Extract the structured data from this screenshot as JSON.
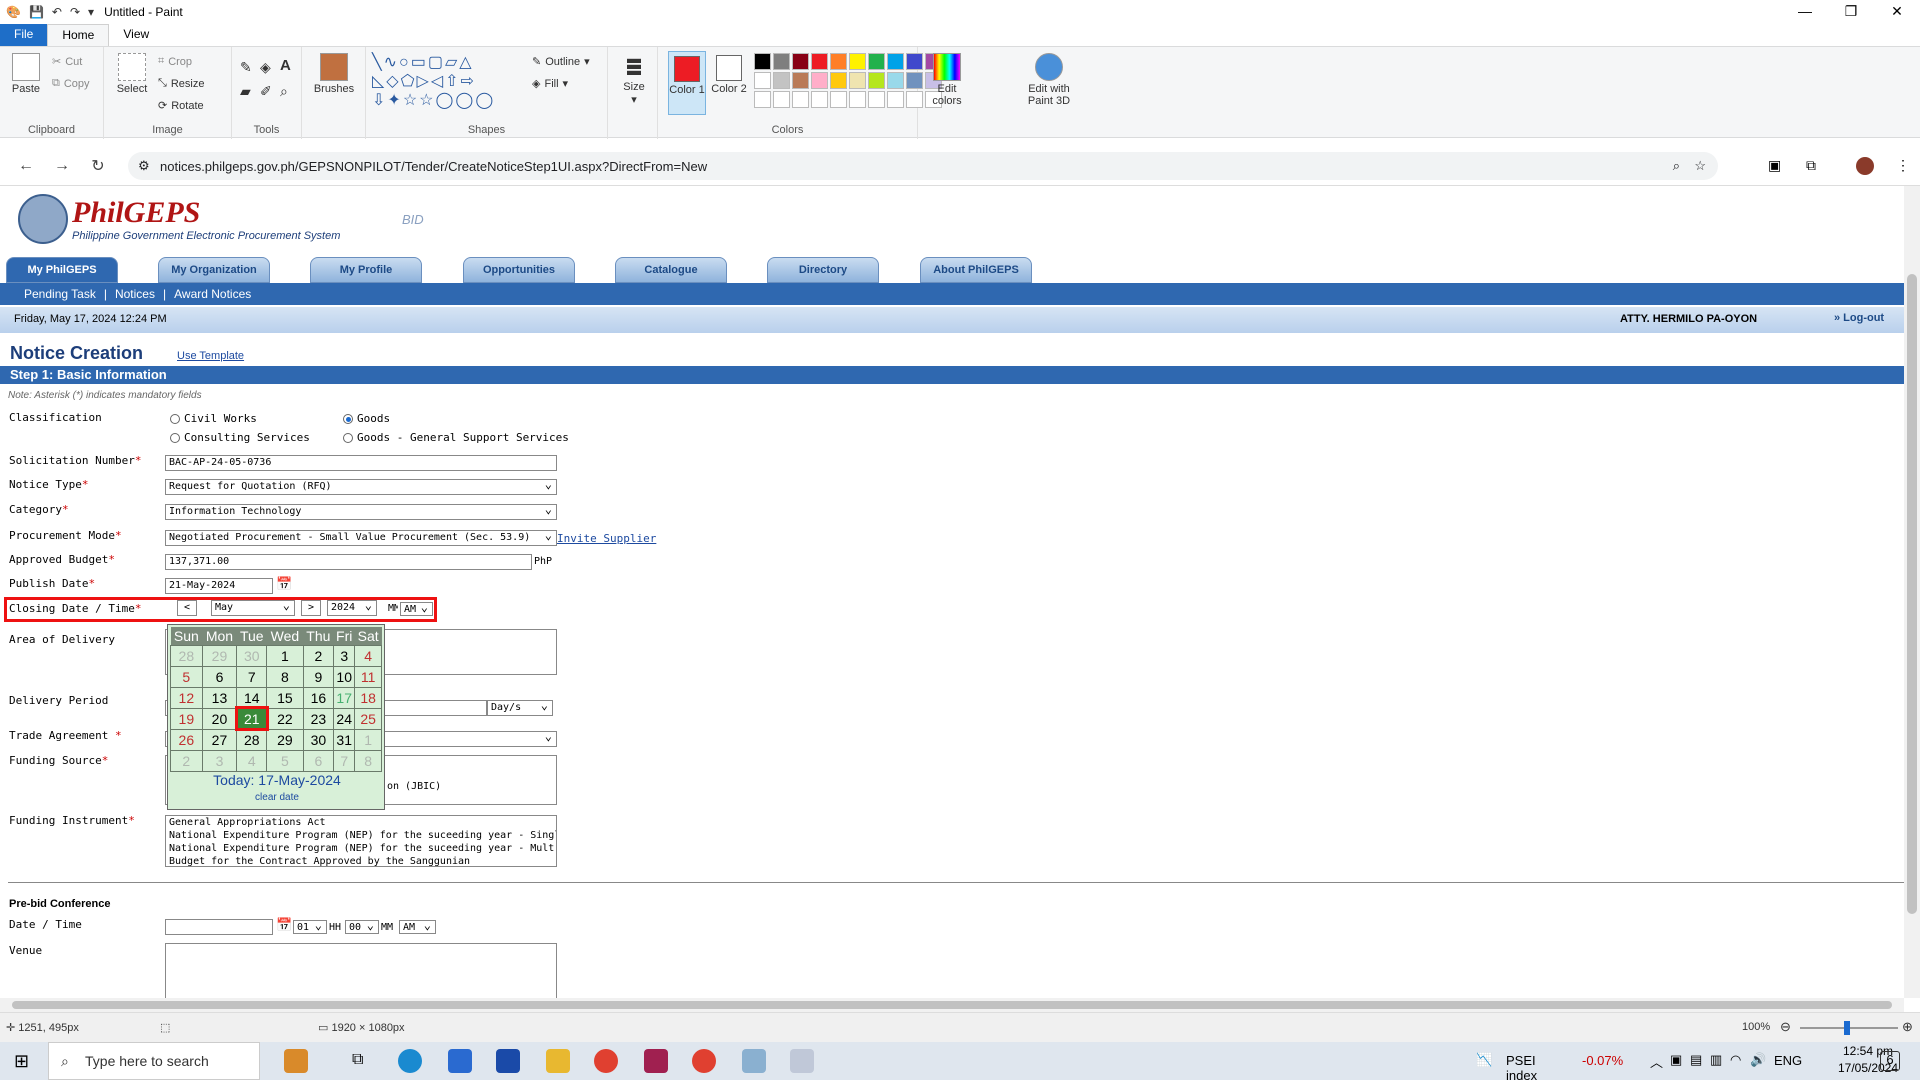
{
  "paint": {
    "window_title": "Untitled - Paint",
    "tabs": [
      "File",
      "Home",
      "View"
    ],
    "clipboard": {
      "paste": "Paste",
      "cut": "Cut",
      "copy": "Copy",
      "group": "Clipboard"
    },
    "image": {
      "select": "Select",
      "crop": "Crop",
      "resize": "Resize",
      "rotate": "Rotate",
      "group": "Image"
    },
    "tools": {
      "group": "Tools"
    },
    "brushes": "Brushes",
    "shapes": {
      "outline": "Outline",
      "fill": "Fill",
      "group": "Shapes"
    },
    "size": "Size",
    "color1": "Color 1",
    "color2": "Color 2",
    "colors_group": "Colors",
    "edit_colors": "Edit colors",
    "edit_paint3d": "Edit with Paint 3D",
    "palette": [
      "#000000",
      "#7f7f7f",
      "#880015",
      "#ed1c24",
      "#ff7f27",
      "#fff200",
      "#22b14c",
      "#00a2e8",
      "#3f48cc",
      "#a349a4",
      "#ffffff",
      "#c3c3c3",
      "#b97a57",
      "#ffaec9",
      "#ffc90e",
      "#efe4b0",
      "#b5e61d",
      "#99d9ea",
      "#7092be",
      "#c8bfe7"
    ],
    "color1_value": "#ed1c24",
    "status": {
      "cursor": "1251, 495px",
      "dimensions": "1920 × 1080px",
      "zoom": "100%"
    }
  },
  "browser": {
    "url": "notices.philgeps.gov.ph/GEPSNONPILOT/Tender/CreateNoticeStep1UI.aspx?DirectFrom=New"
  },
  "site": {
    "logo": "PhilGEPS",
    "logo_sub": "Philippine Government Electronic Procurement System",
    "banner_word": "BID",
    "tabs": [
      "My PhilGEPS",
      "My Organization",
      "My Profile",
      "Opportunities",
      "Catalogue",
      "Directory",
      "About PhilGEPS"
    ],
    "subnav": [
      "Pending Task",
      "|",
      "Notices",
      "|",
      "Award Notices"
    ],
    "date": "Friday, May 17, 2024 12:24 PM",
    "user": "ATTY. HERMILO PA-OYON",
    "logout": "» Log-out",
    "page_title": "Notice Creation",
    "use_template": "Use Template",
    "step": "Step 1: Basic Information",
    "note": "Note: Asterisk (*) indicates mandatory fields"
  },
  "form": {
    "classification": {
      "label": "Classification",
      "options": [
        "Civil Works",
        "Goods",
        "Consulting Services",
        "Goods - General Support Services"
      ],
      "selected": "Goods"
    },
    "solicitation_number": {
      "label": "Solicitation Number",
      "value": "BAC-AP-24-05-0736"
    },
    "notice_type": {
      "label": "Notice Type",
      "value": "Request for Quotation (RFQ)"
    },
    "category": {
      "label": "Category",
      "value": "Information Technology"
    },
    "procurement_mode": {
      "label": "Procurement Mode",
      "value": "Negotiated Procurement - Small Value Procurement (Sec. 53.9)",
      "link": "Invite Supplier"
    },
    "approved_budget": {
      "label": "Approved Budget",
      "value": "137,371.00",
      "unit": "PhP"
    },
    "publish_date": {
      "label": "Publish Date",
      "value": "21-May-2024"
    },
    "closing_date": {
      "label": "Closing Date / Time",
      "prev": "<",
      "month": "May",
      "next": ">",
      "year": "2024",
      "mm": "MM",
      "ampm": "AM"
    },
    "area_of_delivery": {
      "label": "Area of Delivery"
    },
    "delivery_period": {
      "label": "Delivery Period",
      "unit": "Day/s"
    },
    "trade_agreement": {
      "label": "Trade Agreement"
    },
    "funding_source": {
      "label": "Funding Source",
      "visible_fragment": "on (JBIC)"
    },
    "funding_instrument": {
      "label": "Funding Instrument",
      "items": [
        "General Appropriations Act",
        "National Expenditure Program (NEP) for the suceeding year - Singl",
        "National Expenditure Program (NEP) for the suceeding year - Mult",
        "Budget for the Contract Approved by the Sanggunian"
      ]
    },
    "prebid_title": "Pre-bid Conference",
    "prebid_datetime": {
      "label": "Date / Time",
      "hh": "01",
      "hh_label": "HH",
      "mm": "00",
      "mm_label": "MM",
      "ampm": "AM"
    },
    "venue": {
      "label": "Venue"
    }
  },
  "calendar": {
    "headers": [
      "Sun",
      "Mon",
      "Tue",
      "Wed",
      "Thu",
      "Fri",
      "Sat"
    ],
    "weeks": [
      [
        "28",
        "29",
        "30",
        "1",
        "2",
        "3",
        "4"
      ],
      [
        "5",
        "6",
        "7",
        "8",
        "9",
        "10",
        "11"
      ],
      [
        "12",
        "13",
        "14",
        "15",
        "16",
        "17",
        "18"
      ],
      [
        "19",
        "20",
        "21",
        "22",
        "23",
        "24",
        "25"
      ],
      [
        "26",
        "27",
        "28",
        "29",
        "30",
        "31",
        "1"
      ],
      [
        "2",
        "3",
        "4",
        "5",
        "6",
        "7",
        "8"
      ]
    ],
    "selected": "21",
    "today_text": "Today: 17-May-2024",
    "clear": "clear date"
  },
  "taskbar": {
    "search_placeholder": "Type here to search",
    "stock_name": "PSEI index",
    "stock_change": "-0.07%",
    "lang": "ENG",
    "time": "12:54 pm",
    "date": "17/05/2024",
    "notifications": "6"
  }
}
